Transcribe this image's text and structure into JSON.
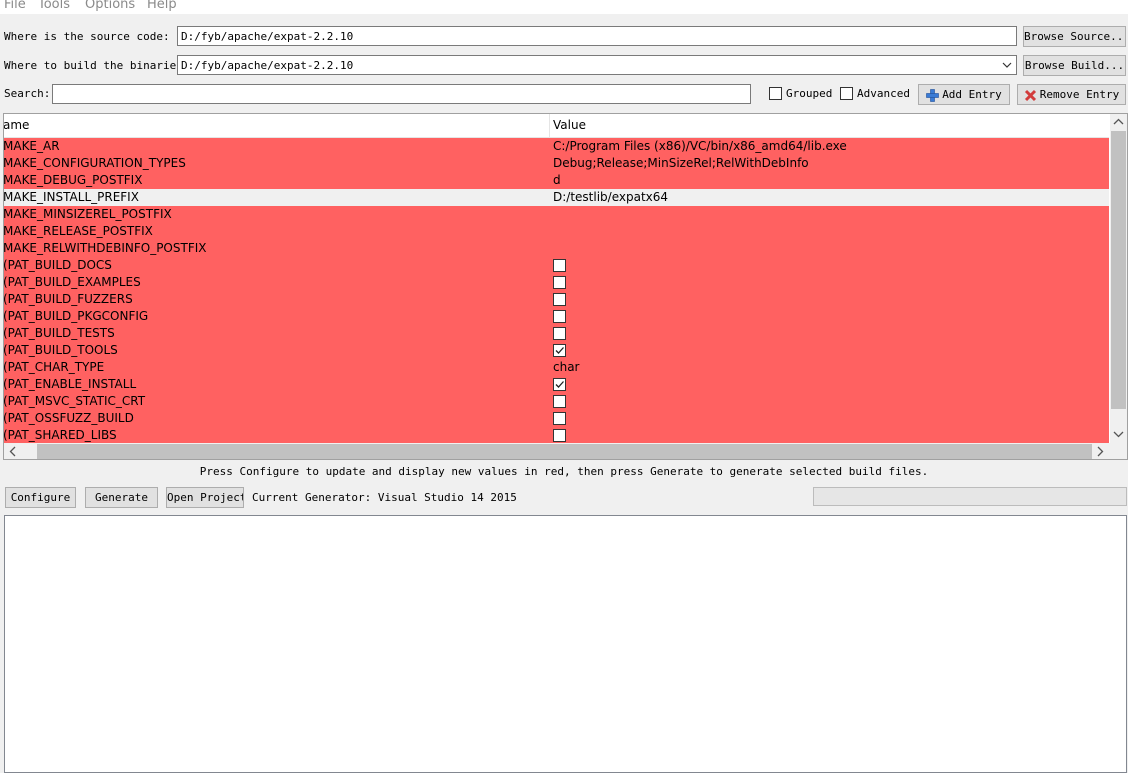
{
  "menu": [
    "File",
    "Tools",
    "Options",
    "Help"
  ],
  "source": {
    "label": "Where is the source code:",
    "value": "D:/fyb/apache/expat-2.2.10",
    "browse": "Browse Source..."
  },
  "build": {
    "label": "Where to build the binaries:",
    "value": "D:/fyb/apache/expat-2.2.10",
    "browse": "Browse Build..."
  },
  "search": {
    "label": "Search:",
    "value": ""
  },
  "options": {
    "grouped": "Grouped",
    "advanced": "Advanced",
    "add_entry": "Add Entry",
    "remove_entry": "Remove Entry"
  },
  "table": {
    "headers": {
      "name": "ame",
      "value": "Value"
    },
    "rows": [
      {
        "name": "MAKE_AR",
        "value": "C:/Program Files (x86)/VC/bin/x86_amd64/lib.exe",
        "kind": "text",
        "red": true
      },
      {
        "name": "MAKE_CONFIGURATION_TYPES",
        "value": "Debug;Release;MinSizeRel;RelWithDebInfo",
        "kind": "text",
        "red": true
      },
      {
        "name": "MAKE_DEBUG_POSTFIX",
        "value": "d",
        "kind": "text",
        "red": true
      },
      {
        "name": "MAKE_INSTALL_PREFIX",
        "value": "D:/testlib/expatx64",
        "kind": "text",
        "red": false
      },
      {
        "name": "MAKE_MINSIZEREL_POSTFIX",
        "value": "",
        "kind": "text",
        "red": true
      },
      {
        "name": "MAKE_RELEASE_POSTFIX",
        "value": "",
        "kind": "text",
        "red": true
      },
      {
        "name": "MAKE_RELWITHDEBINFO_POSTFIX",
        "value": "",
        "kind": "text",
        "red": true
      },
      {
        "name": "(PAT_BUILD_DOCS",
        "value": false,
        "kind": "bool",
        "red": true
      },
      {
        "name": "(PAT_BUILD_EXAMPLES",
        "value": false,
        "kind": "bool",
        "red": true
      },
      {
        "name": "(PAT_BUILD_FUZZERS",
        "value": false,
        "kind": "bool",
        "red": true
      },
      {
        "name": "(PAT_BUILD_PKGCONFIG",
        "value": false,
        "kind": "bool",
        "red": true
      },
      {
        "name": "(PAT_BUILD_TESTS",
        "value": false,
        "kind": "bool",
        "red": true
      },
      {
        "name": "(PAT_BUILD_TOOLS",
        "value": true,
        "kind": "bool",
        "red": true
      },
      {
        "name": "(PAT_CHAR_TYPE",
        "value": "char",
        "kind": "text",
        "red": true
      },
      {
        "name": "(PAT_ENABLE_INSTALL",
        "value": true,
        "kind": "bool",
        "red": true
      },
      {
        "name": "(PAT_MSVC_STATIC_CRT",
        "value": false,
        "kind": "bool",
        "red": true
      },
      {
        "name": "(PAT_OSSFUZZ_BUILD",
        "value": false,
        "kind": "bool",
        "red": true
      },
      {
        "name": "(PAT_SHARED_LIBS",
        "value": false,
        "kind": "bool",
        "red": true
      }
    ]
  },
  "hint": "Press Configure to update and display new values in red, then press Generate to generate selected build files.",
  "actions": {
    "configure": "Configure",
    "generate": "Generate",
    "open_project": "Open Project",
    "generator": "Current Generator: Visual Studio 14 2015"
  },
  "colors": {
    "changed_row": "#ff6161",
    "normal_row": "#f0f0f0"
  }
}
